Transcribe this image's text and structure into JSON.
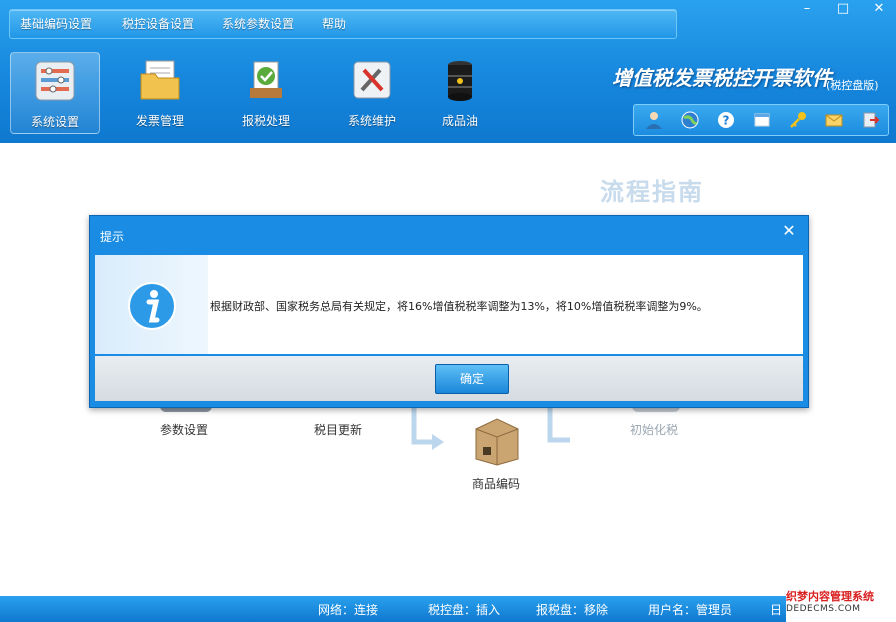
{
  "menu": [
    "基础编码设置",
    "税控设备设置",
    "系统参数设置",
    "帮助"
  ],
  "window_controls": {
    "minimize": "–",
    "maximize": "□",
    "close": "✕"
  },
  "toolbar": [
    {
      "label": "系统设置",
      "icon": "settings-panel-icon"
    },
    {
      "label": "发票管理",
      "icon": "folder-documents-icon"
    },
    {
      "label": "报税处理",
      "icon": "tax-report-icon"
    },
    {
      "label": "系统维护",
      "icon": "maintenance-tools-icon"
    },
    {
      "label": "成品油",
      "icon": "oil-barrel-icon"
    }
  ],
  "app": {
    "title": "增值税发票税控开票软件",
    "edition": "(税控盘版)"
  },
  "quick_icons": [
    "user-icon",
    "globe-icon",
    "help-icon",
    "window-icon",
    "key-icon",
    "mail-icon",
    "exit-icon"
  ],
  "guide": {
    "title": "流程指南",
    "steps": [
      "参数设置",
      "税目更新",
      "商品编码",
      "初始化税"
    ]
  },
  "dialog": {
    "title": "提示",
    "close": "✕",
    "message": "根据财政部、国家税务总局有关规定，将16%增值税税率调整为13%，将10%增值税税率调整为9%。",
    "ok": "确定"
  },
  "status": [
    {
      "label": "网络",
      "value": "连接"
    },
    {
      "label": "税控盘",
      "value": "插入"
    },
    {
      "label": "报税盘",
      "value": "移除"
    },
    {
      "label": "用户名",
      "value": "管理员"
    },
    {
      "label": "日",
      "value": ""
    }
  ],
  "watermark": {
    "line1": "织梦内容管理系统",
    "line2": "DEDECMS.COM"
  },
  "colors": {
    "primary": "#1687dd",
    "dialog_header": "#1a8ce3",
    "ok_button": "#1b86da"
  }
}
